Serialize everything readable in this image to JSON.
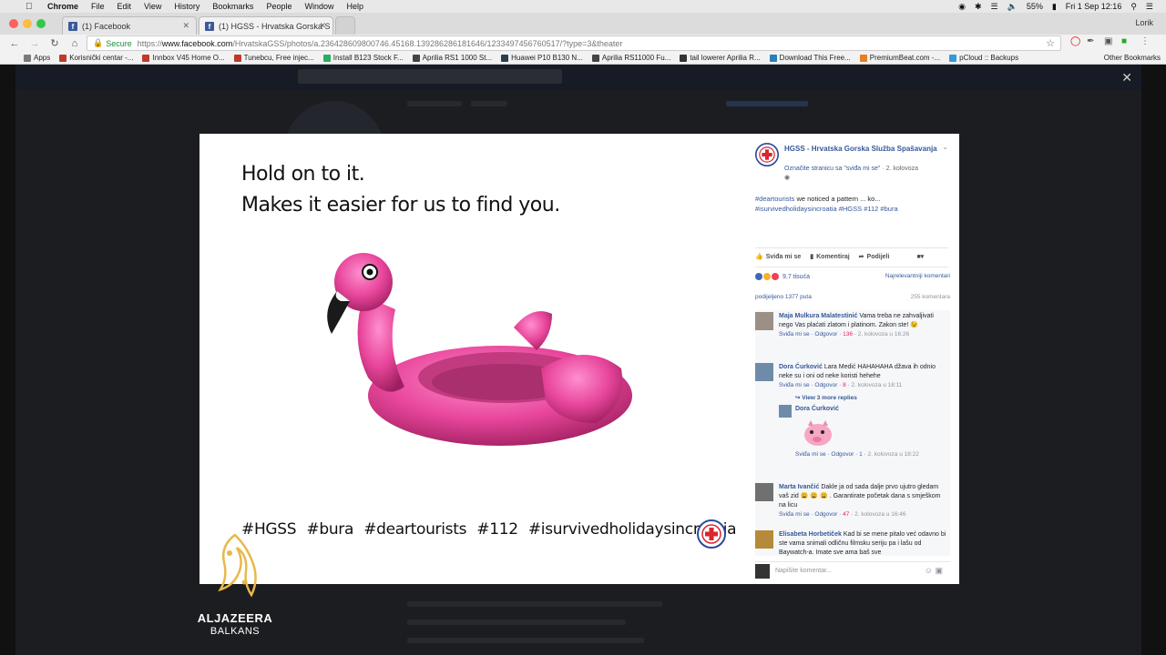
{
  "menubar": {
    "app": "Chrome",
    "items": [
      "File",
      "Edit",
      "View",
      "History",
      "Bookmarks",
      "People",
      "Window",
      "Help"
    ],
    "battery": "55%",
    "clock": "Fri 1 Sep 12:16"
  },
  "tabs": [
    {
      "title": "(1) Facebook"
    },
    {
      "title": "(1) HGSS - Hrvatska Gorska S"
    }
  ],
  "profile": "Lorik",
  "address": {
    "secure_label": "Secure",
    "scheme": "https://",
    "domain": "www.facebook.com",
    "path": "/HrvatskaGSS/photos/a.236428609800746.45168.139286286181646/1233497456760517/?type=3&theater"
  },
  "bookmarks": [
    {
      "label": "Apps",
      "color": "#7a7a7a"
    },
    {
      "label": "Korisnički centar -...",
      "color": "#c0392b"
    },
    {
      "label": "Innbox V45 Home O...",
      "color": "#c0392b"
    },
    {
      "label": "Tunebcu, Free injec...",
      "color": "#c0392b"
    },
    {
      "label": "Install B123 Stock F...",
      "color": "#27ae60"
    },
    {
      "label": "Aprilia RS1 1000 St...",
      "color": "#444444"
    },
    {
      "label": "Huawei P10 B130 N...",
      "color": "#2c3e50"
    },
    {
      "label": "Aprilia RS11000 Fu...",
      "color": "#444444"
    },
    {
      "label": "tail lowerer Aprilia R...",
      "color": "#333333"
    },
    {
      "label": "Download This Free...",
      "color": "#2980b9"
    },
    {
      "label": "PremiumBeat.com -...",
      "color": "#e67e22"
    },
    {
      "label": "pCloud :: Backups",
      "color": "#3498db"
    }
  ],
  "bookmarks_other": "Other Bookmarks",
  "poster": {
    "line1": "Hold on to it.",
    "line2": "Makes it easier for us to find you.",
    "tags": "#HGSS #bura #deartourists #112 #isurvivedholidaysincroatia"
  },
  "post": {
    "page_name": "HGSS - Hrvatska Gorska Služba Spašavanja",
    "like_prompt": "Označite stranicu sa \"sviđa mi se\"",
    "date": "2. kolovoza",
    "text_tag": "#deartourists",
    "text": " we noticed a pattern ... ko...",
    "tags_line": "#isurvivedholidaysincroatia #HGSS #112 #bura",
    "actions": {
      "like": "Sviđa mi se",
      "comment": "Komentiraj",
      "share": "Podijeli"
    },
    "reactions": "9,7 tisuća",
    "sort": "Najrelevantniji komentari",
    "shares": "podijeljeno 1377 puta",
    "comment_count": "255 komentara",
    "write_placeholder": "Napišite komentar..."
  },
  "comments": [
    {
      "name": "Maja Mulkura Malatestinić",
      "text": "Vama treba ne zahvaljivati nego Vas plaćati zlatom i platinom. Zakon ste! 😉",
      "like": "Sviđa mi se",
      "reply": "Odgovor",
      "count": "136",
      "time": "2. kolovoza u 16:26"
    },
    {
      "name": "Dora Ćurković",
      "text": "Lara Medić HAHAHAHA džava ih odnio neke su i oni od neke koristi hehehe",
      "like": "Sviđa mi se",
      "reply": "Odgovor",
      "count": "8",
      "time": "2. kolovoza u 18:11"
    },
    {
      "name": "Marta Ivančić",
      "text": "Dakle ja od sada dalje prvo ujutro gledam vaš zid 😩 😩 😩 . Garantirate početak dana s smješkom na licu",
      "like": "Sviđa mi se",
      "reply": "Odgovor",
      "count": "47",
      "time": "2. kolovoza u 16:46"
    },
    {
      "name": "Elisabeta Horbetiček",
      "text": "Kad bi se mene pitalo već odavno bi ste vama snimali odličnu filmsku seriju pa i lašu od Baywatch-a. Imate sve ama baš sve",
      "like": "",
      "reply": "",
      "count": "",
      "time": ""
    }
  ],
  "replies": {
    "view_more": "View 3 more replies",
    "reply_name": "Dora Ćurković",
    "like": "Sviđa mi se",
    "reply": "Odgovor",
    "count": "1",
    "time": "2. kolovoza u 18:22"
  },
  "watermark": {
    "brand": "ALJAZEERA",
    "region": "BALKANS"
  },
  "colors": {
    "fb_blue": "#365899",
    "flamingo_pink": "#e8469b",
    "hgss_red": "#d9262f"
  }
}
